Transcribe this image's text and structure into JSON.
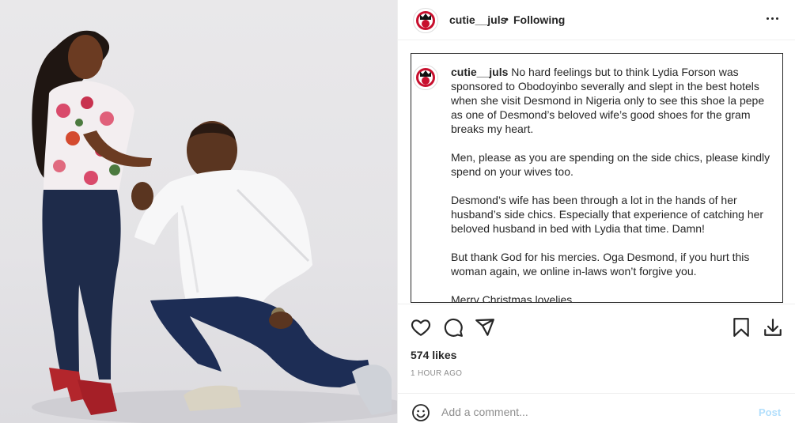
{
  "post": {
    "username": "cutie__juls",
    "separator": "•",
    "follow_status": "Following",
    "avatar_icon": "brand-logo-avatar",
    "caption_paragraphs": [
      "No hard feelings but to think Lydia Forson was sponsored to Obodoyinbo severally and slept in the best hotels when she visit Desmond in Nigeria only to see this shoe la pepe as one of Desmond’s beloved wife’s good shoes for the gram breaks my heart.",
      "Men, please as you are spending on the side chics, please kindly spend on your wives too.",
      "Desmond’s wife has been through a lot in the hands of her husband’s side chics. Especially that experience of catching her beloved husband in bed with Lydia that time. Damn!",
      "But thank God for his mercies. Oga Desmond, if you hurt this woman again, we online in-laws won’t forgive you.",
      "Merry Christmas lovelies"
    ],
    "likes": "574 likes",
    "timestamp": "1 HOUR AGO"
  },
  "actions": {
    "like_icon": "heart-icon",
    "comment_icon": "comment-icon",
    "share_icon": "send-icon",
    "save_icon": "bookmark-icon",
    "download_icon": "download-icon"
  },
  "comment": {
    "placeholder": "Add a comment...",
    "post_label": "Post",
    "emoji_icon": "emoji-icon"
  },
  "colors": {
    "text": "#262626",
    "muted": "#8e8e8e",
    "post_disabled": "#b2dffc",
    "divider": "#efefef"
  }
}
